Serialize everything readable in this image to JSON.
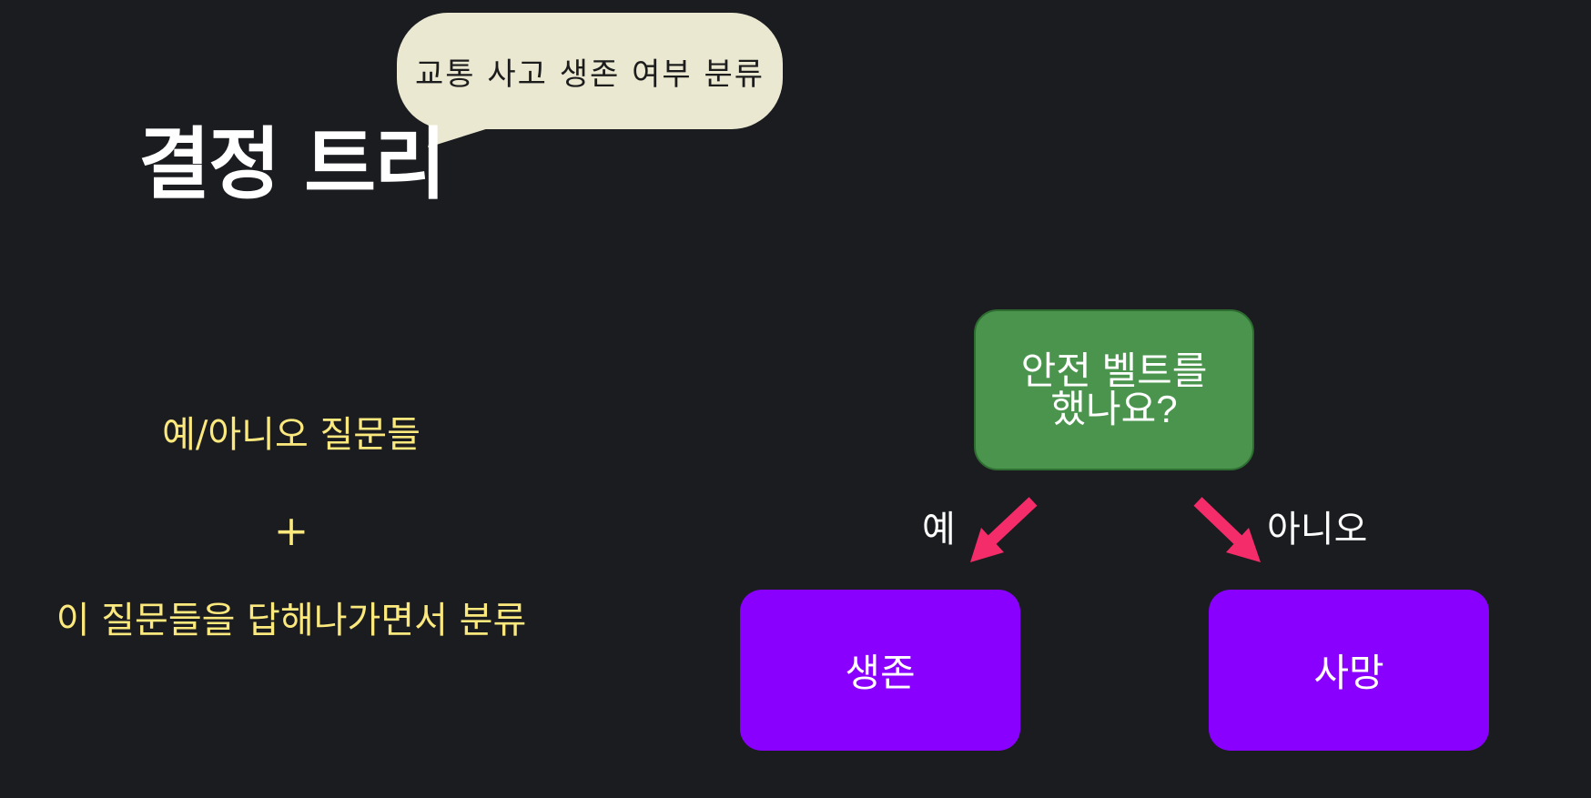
{
  "bubble": {
    "text": "교통 사고 생존 여부 분류"
  },
  "title": "결정 트리",
  "notes": {
    "line1": "예/아니오 질문들",
    "plus": "+",
    "line2": "이 질문들을 답해나가면서 분류"
  },
  "tree": {
    "root": {
      "line1": "안전 벨트를",
      "line2": "했나요?"
    },
    "edges": {
      "yes": "예",
      "no": "아니오"
    },
    "leaves": {
      "left": "생존",
      "right": "사망"
    }
  },
  "colors": {
    "background": "#1b1c20",
    "bubble": "#ebe8d2",
    "note_text": "#fbe97e",
    "root_node": "#4a944d",
    "leaf_node": "#8a00ff",
    "arrow": "#f42c6a"
  }
}
